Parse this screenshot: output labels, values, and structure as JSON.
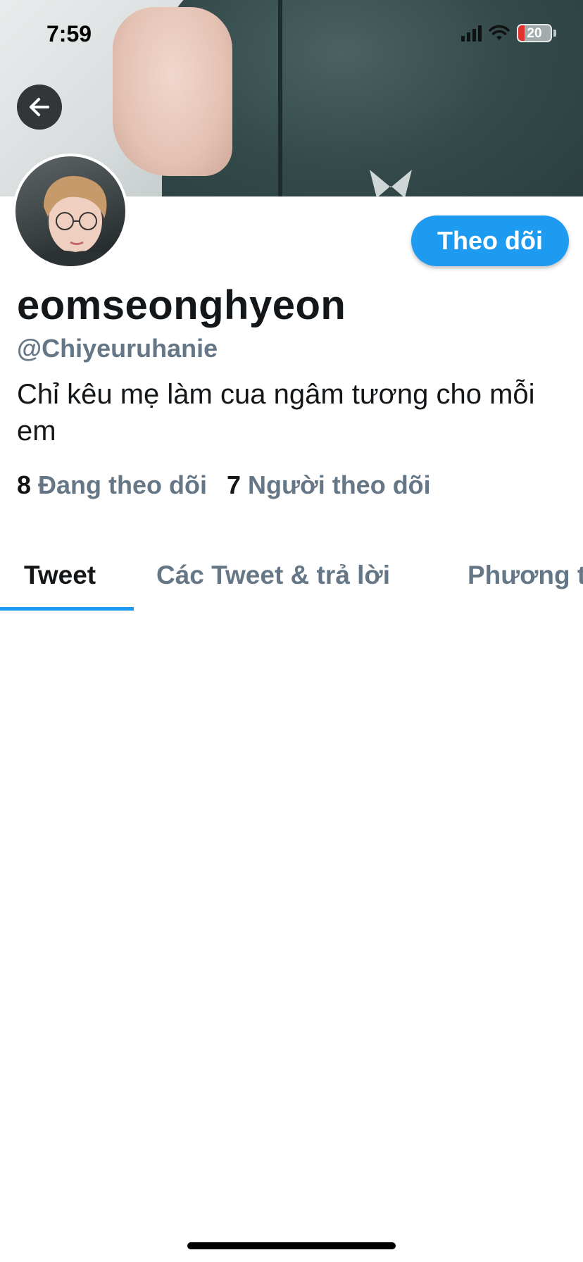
{
  "status_bar": {
    "time": "7:59",
    "battery_level": "20",
    "icons": [
      "signal-icon",
      "wifi-icon",
      "battery-icon"
    ]
  },
  "header": {
    "back_icon": "arrow-left-icon"
  },
  "profile": {
    "display_name": "eomseonghyeon",
    "handle": "@Chiyeuruhanie",
    "bio": "Chỉ kêu mẹ làm cua ngâm tương cho mỗi em",
    "follow_label": "Theo dõi",
    "following_count": "8",
    "following_label": "Đang theo dõi",
    "followers_count": "7",
    "followers_label": "Người theo dõi"
  },
  "tabs": [
    {
      "label": "Tweet",
      "active": true
    },
    {
      "label": "Các Tweet & trả lời",
      "active": false
    },
    {
      "label": "Phương tiện",
      "active": false
    }
  ],
  "colors": {
    "accent": "#1d9bf0",
    "primary_text": "#14171a",
    "secondary_text": "#657786",
    "battery_low": "#e0312d"
  }
}
